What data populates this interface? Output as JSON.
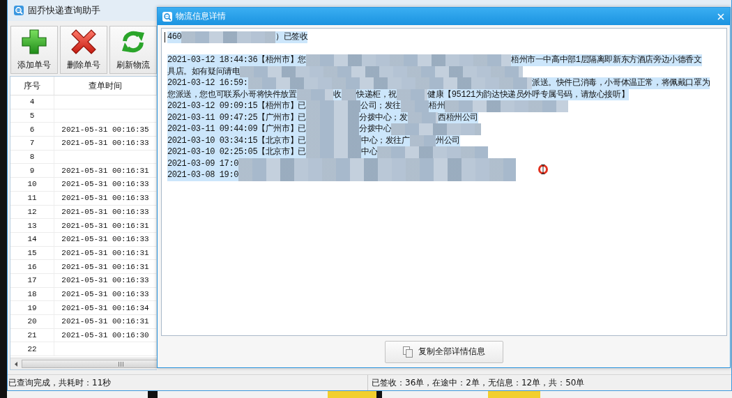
{
  "main_window": {
    "title": "固乔快递查询助手",
    "toolbar": [
      {
        "kind": "add",
        "label": "添加单号"
      },
      {
        "kind": "delete",
        "label": "删除单号"
      },
      {
        "kind": "refresh",
        "label": "刷新物流"
      }
    ],
    "table": {
      "columns": [
        "序号",
        "查单时间"
      ],
      "rows": [
        {
          "number": "4"
        },
        {
          "number": "5"
        },
        {
          "number": "6",
          "time": "2021-05-31 00:16:35"
        },
        {
          "number": "7",
          "time": "2021-05-31 00:16:33"
        },
        {
          "number": "8"
        },
        {
          "number": "9",
          "time": "2021-05-31 00:16:31"
        },
        {
          "number": "10",
          "time": "2021-05-31 00:16:33"
        },
        {
          "number": "11",
          "time": "2021-05-31 00:16:33"
        },
        {
          "number": "12",
          "time": "2021-05-31 00:16:33"
        },
        {
          "number": "13",
          "time": "2021-05-31 00:16:31"
        },
        {
          "number": "14",
          "time": "2021-05-31 00:16:33"
        },
        {
          "number": "15",
          "time": "2021-05-31 00:16:31"
        },
        {
          "number": "16",
          "time": "2021-05-31 00:16:31"
        },
        {
          "number": "17",
          "time": "2021-05-31 00:16:33"
        },
        {
          "number": "18",
          "time": "2021-05-31 00:16:33"
        },
        {
          "number": "19",
          "time": "2021-05-31 00:16:34"
        },
        {
          "number": "20",
          "time": "2021-05-31 00:16:31"
        },
        {
          "number": "21",
          "time": "2021-05-31 00:16:30"
        },
        {
          "number": "22"
        }
      ]
    },
    "status_bar": {
      "left": "已查询完成，共耗时：11秒",
      "right": "已签收：36单，在途中：2单，无信息：12单，共：50单"
    }
  },
  "dialog": {
    "title": "物流信息详情",
    "details": {
      "selected": true,
      "first_line": [
        "460",
        "）已签收"
      ],
      "lines": [
        [
          "2021-03-12 18:44:36【梧州市】您",
          "梧州市一中高中部1层隔离即新东方酒店旁边小德香文"
        ],
        [
          "具店。如有疑问请电"
        ],
        [
          "2021-03-12 16:59:",
          "派送。快件已消毒，小哥体温正常，将佩戴口罩为"
        ],
        [
          "您派送，您也可联系小哥将快件放置",
          "收",
          "快递柜，祝",
          "健康【95121为韵达快递员外呼专属号码，请放心接听】"
        ],
        [
          "2021-03-12 09:09:15【梧州市】已",
          "公司；发往",
          "梧州"
        ],
        [
          "2021-03-11 09:47:25【广州市】已",
          "分拨中心；发",
          "西梧州公司"
        ],
        [
          "2021-03-11 09:44:09【广州市】已",
          "分拨中心"
        ],
        [
          "2021-03-10 03:34:15【北京市】已",
          "中心；发往广",
          "州公司"
        ],
        [
          "2021-03-10 02:25:05【北京市】已",
          "中心"
        ],
        [
          "2021-03-09 17:0"
        ],
        [
          "2021-03-08 19:0"
        ]
      ]
    },
    "copy_button": "复制全部详情信息"
  }
}
